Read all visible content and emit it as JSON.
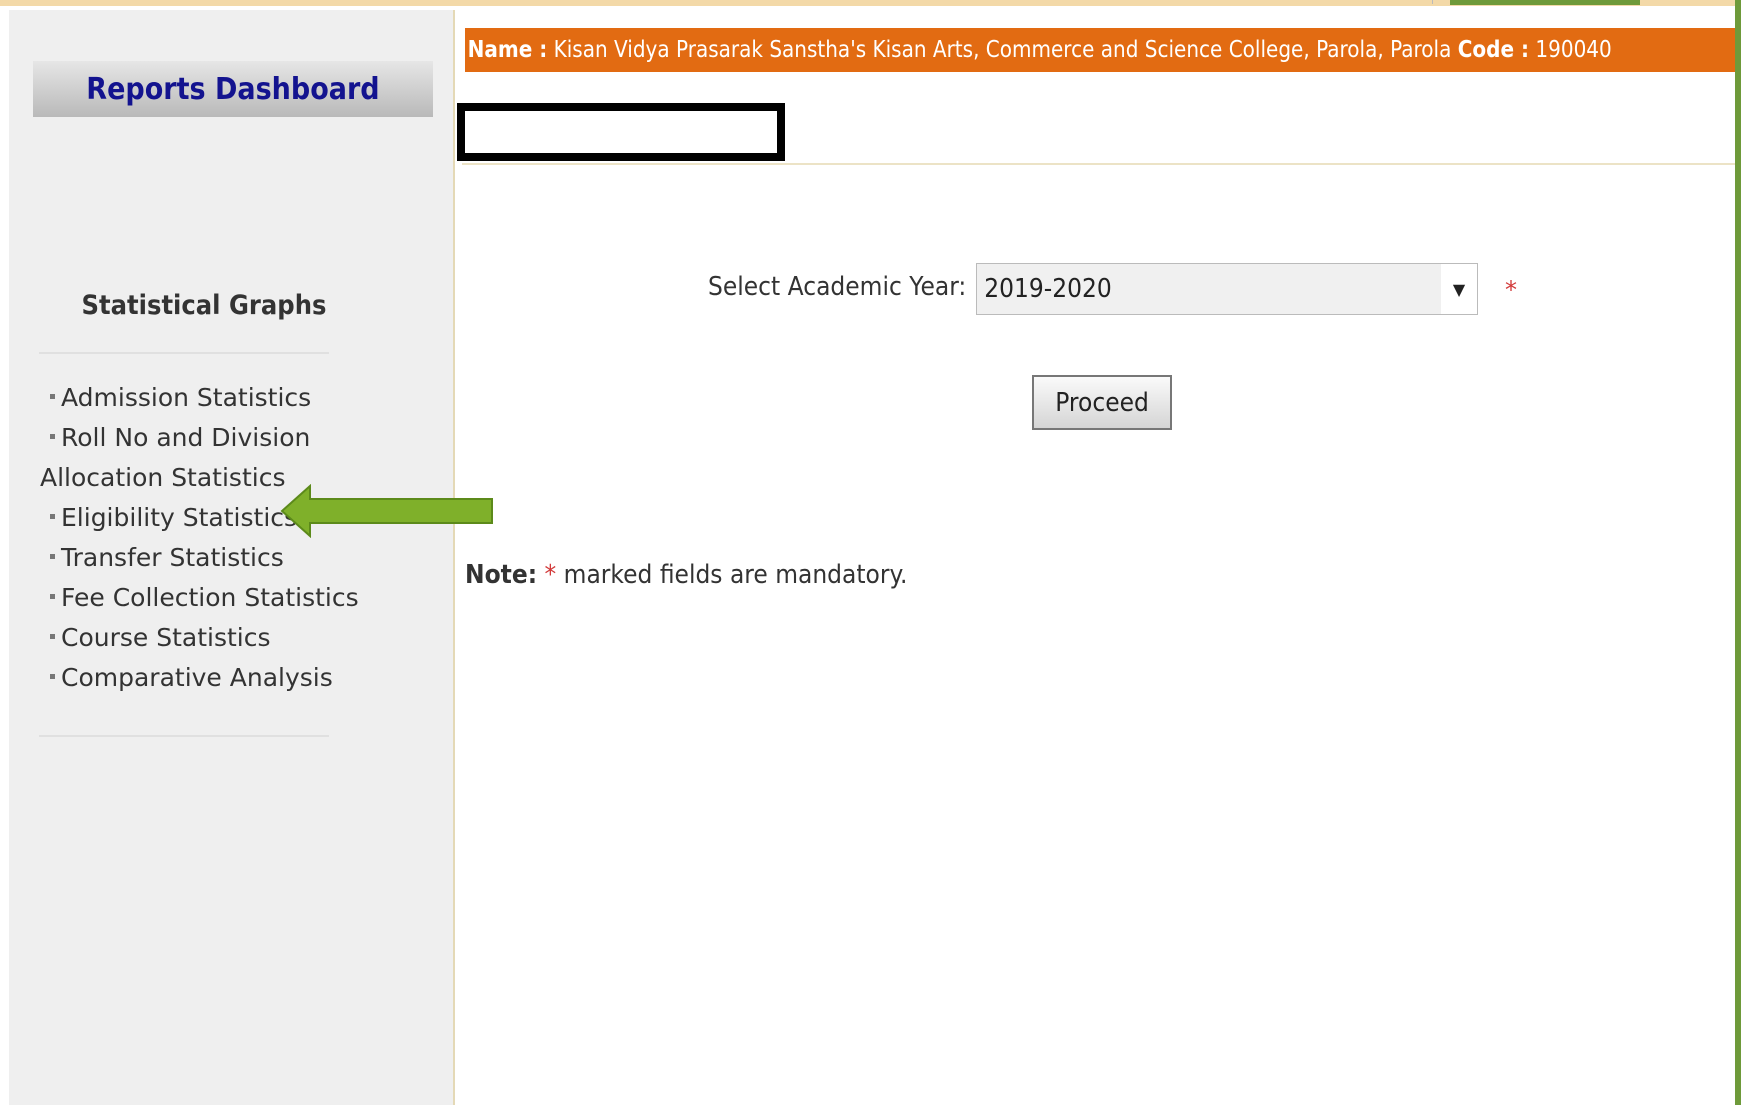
{
  "sidebar": {
    "dashboard_title": "Reports Dashboard",
    "section_title": "Statistical Graphs",
    "links": [
      "Admission Statistics",
      "Roll No and Division",
      "Allocation Statistics",
      "Eligibility Statistics",
      "Transfer Statistics",
      "Fee Collection Statistics",
      "Course Statistics",
      "Comparative Analysis"
    ]
  },
  "header": {
    "name_label": "Name :",
    "name_value": "Kisan Vidya Prasarak Sanstha's Kisan Arts, Commerce and Science College, Parola, Parola",
    "code_label": "Code :",
    "code_value": "190040"
  },
  "form": {
    "year_label": "Select Academic Year:",
    "year_value": "2019-2020",
    "required_mark": "*",
    "proceed_label": "Proceed"
  },
  "note": {
    "label": "Note:",
    "star": "*",
    "text": "marked fields are mandatory."
  },
  "colors": {
    "header_bar": "#e26b12",
    "dashboard_title": "#13138f",
    "arrow": "#7fb02a",
    "required": "#d23a3a"
  },
  "icons": {
    "dropdown": "chevron-down-icon",
    "pointer": "arrow-left-icon"
  }
}
